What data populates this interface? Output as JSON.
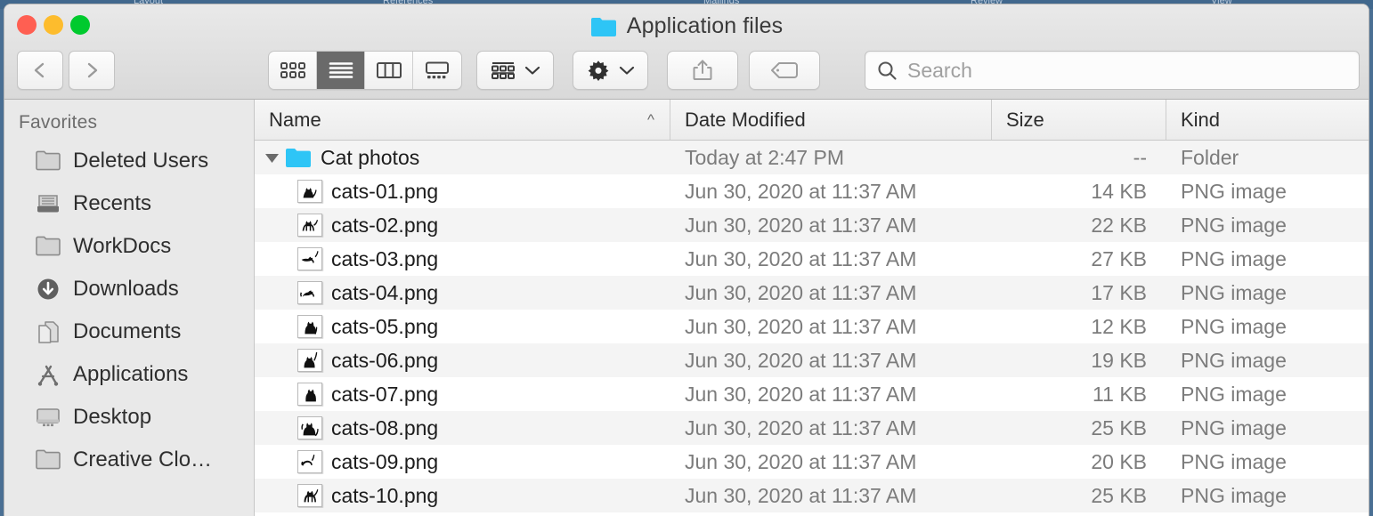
{
  "background_menubar": {
    "items": [
      "Layout",
      "References",
      "Mailings",
      "Review",
      "View"
    ]
  },
  "window": {
    "title": "Application files",
    "title_icon": "folder-icon",
    "traffic_lights": [
      {
        "name": "close-button",
        "color": "#ff5f52"
      },
      {
        "name": "minimize-button",
        "color": "#fdbc2d"
      },
      {
        "name": "maximize-button",
        "color": "#00ca2e"
      }
    ]
  },
  "toolbar": {
    "back_icon": "chevron-left-icon",
    "forward_icon": "chevron-right-icon",
    "view_modes": [
      {
        "name": "icon-view",
        "icon": "grid-icon",
        "active": false
      },
      {
        "name": "list-view",
        "icon": "list-icon",
        "active": true
      },
      {
        "name": "column-view",
        "icon": "columns-icon",
        "active": false
      },
      {
        "name": "gallery-view",
        "icon": "gallery-icon",
        "active": false
      }
    ],
    "arrange_button": {
      "icon": "arrange-grid-icon",
      "chevron": "chevron-down-icon"
    },
    "action_button": {
      "icon": "gear-icon",
      "chevron": "chevron-down-icon"
    },
    "share_button": {
      "icon": "share-icon"
    },
    "tag_button": {
      "icon": "tag-icon"
    }
  },
  "search": {
    "icon": "search-icon",
    "placeholder": "Search",
    "value": ""
  },
  "sidebar": {
    "header": "Favorites",
    "items": [
      {
        "label": "Deleted Users",
        "icon": "folder-icon"
      },
      {
        "label": "Recents",
        "icon": "recents-icon"
      },
      {
        "label": "WorkDocs",
        "icon": "folder-icon"
      },
      {
        "label": "Downloads",
        "icon": "downloads-icon"
      },
      {
        "label": "Documents",
        "icon": "documents-icon"
      },
      {
        "label": "Applications",
        "icon": "applications-icon"
      },
      {
        "label": "Desktop",
        "icon": "desktop-icon"
      },
      {
        "label": "Creative Clo…",
        "icon": "folder-icon"
      }
    ]
  },
  "file_list": {
    "columns": [
      {
        "key": "name",
        "label": "Name",
        "sort": "ascending",
        "sort_icon": "chevron-up-icon"
      },
      {
        "key": "date",
        "label": "Date Modified"
      },
      {
        "key": "size",
        "label": "Size"
      },
      {
        "key": "kind",
        "label": "Kind"
      }
    ],
    "rows": [
      {
        "name": "Cat photos",
        "date": "Today at 2:47 PM",
        "size": "--",
        "kind": "Folder",
        "type": "folder",
        "expanded": true,
        "icon": "folder-icon"
      },
      {
        "name": "cats-01.png",
        "date": "Jun 30, 2020 at 11:37 AM",
        "size": "14 KB",
        "kind": "PNG image",
        "type": "file",
        "icon": "cat-thumbnail-icon"
      },
      {
        "name": "cats-02.png",
        "date": "Jun 30, 2020 at 11:37 AM",
        "size": "22 KB",
        "kind": "PNG image",
        "type": "file",
        "icon": "cat-thumbnail-icon"
      },
      {
        "name": "cats-03.png",
        "date": "Jun 30, 2020 at 11:37 AM",
        "size": "27 KB",
        "kind": "PNG image",
        "type": "file",
        "icon": "cat-thumbnail-icon"
      },
      {
        "name": "cats-04.png",
        "date": "Jun 30, 2020 at 11:37 AM",
        "size": "17 KB",
        "kind": "PNG image",
        "type": "file",
        "icon": "cat-thumbnail-icon"
      },
      {
        "name": "cats-05.png",
        "date": "Jun 30, 2020 at 11:37 AM",
        "size": "12 KB",
        "kind": "PNG image",
        "type": "file",
        "icon": "cat-thumbnail-icon"
      },
      {
        "name": "cats-06.png",
        "date": "Jun 30, 2020 at 11:37 AM",
        "size": "19 KB",
        "kind": "PNG image",
        "type": "file",
        "icon": "cat-thumbnail-icon"
      },
      {
        "name": "cats-07.png",
        "date": "Jun 30, 2020 at 11:37 AM",
        "size": "11 KB",
        "kind": "PNG image",
        "type": "file",
        "icon": "cat-thumbnail-icon"
      },
      {
        "name": "cats-08.png",
        "date": "Jun 30, 2020 at 11:37 AM",
        "size": "25 KB",
        "kind": "PNG image",
        "type": "file",
        "icon": "cat-thumbnail-icon"
      },
      {
        "name": "cats-09.png",
        "date": "Jun 30, 2020 at 11:37 AM",
        "size": "20 KB",
        "kind": "PNG image",
        "type": "file",
        "icon": "cat-thumbnail-icon"
      },
      {
        "name": "cats-10.png",
        "date": "Jun 30, 2020 at 11:37 AM",
        "size": "25 KB",
        "kind": "PNG image",
        "type": "file",
        "icon": "cat-thumbnail-icon"
      }
    ]
  },
  "colors": {
    "folder_blue": "#2ec5f6",
    "window_chrome": "#e4e4e4",
    "sidebar_bg": "#e9e9e9",
    "row_stripe": "#f4f4f4"
  }
}
